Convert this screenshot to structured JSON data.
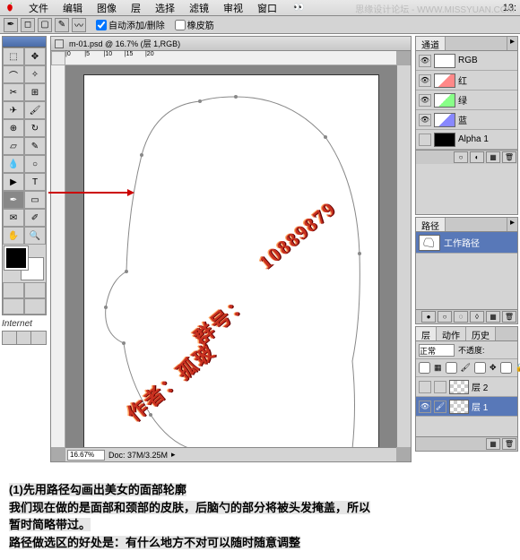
{
  "watermark": "思缘设计论坛 - WWW.MISSYUAN.COM",
  "menu": {
    "items": [
      "文件",
      "编辑",
      "图像",
      "层",
      "选择",
      "滤镜",
      "审视",
      "窗口"
    ],
    "time": "13:"
  },
  "option_bar": {
    "auto_add_delete": "自动添加/删除",
    "rubber_band": "橡皮筋"
  },
  "doc": {
    "title": "m-01.psd @ 16.7% (层 1,RGB)",
    "zoom": "16.67%",
    "docsize": "Doc: 37M/3.25M"
  },
  "channels_panel": {
    "tab": "通道",
    "rgb": "RGB",
    "red": "红",
    "green": "绿",
    "blue": "蓝",
    "alpha": "Alpha 1"
  },
  "paths_panel": {
    "tab": "路径",
    "work_path": "工作路径"
  },
  "layers_panel": {
    "tabs": {
      "layers": "层",
      "actions": "动作",
      "history": "历史"
    },
    "mode": "正常",
    "opacity_label": "不透度:",
    "layer1": "层 1",
    "layer2": "层 2"
  },
  "internet_label": "Internet",
  "diag": {
    "author": "作者：孤玻",
    "group": "群号：",
    "number": "10889879"
  },
  "caption": {
    "line1": "(1)先用路径勾画出美女的面部轮廓",
    "line2": "我们现在做的是面部和颈部的皮肤，后脑勺的部分将被头发掩盖，所以",
    "line3": "暂时简略带过。",
    "line4": "路径做选区的好处是：有什么地方不对可以随时随意调整"
  }
}
